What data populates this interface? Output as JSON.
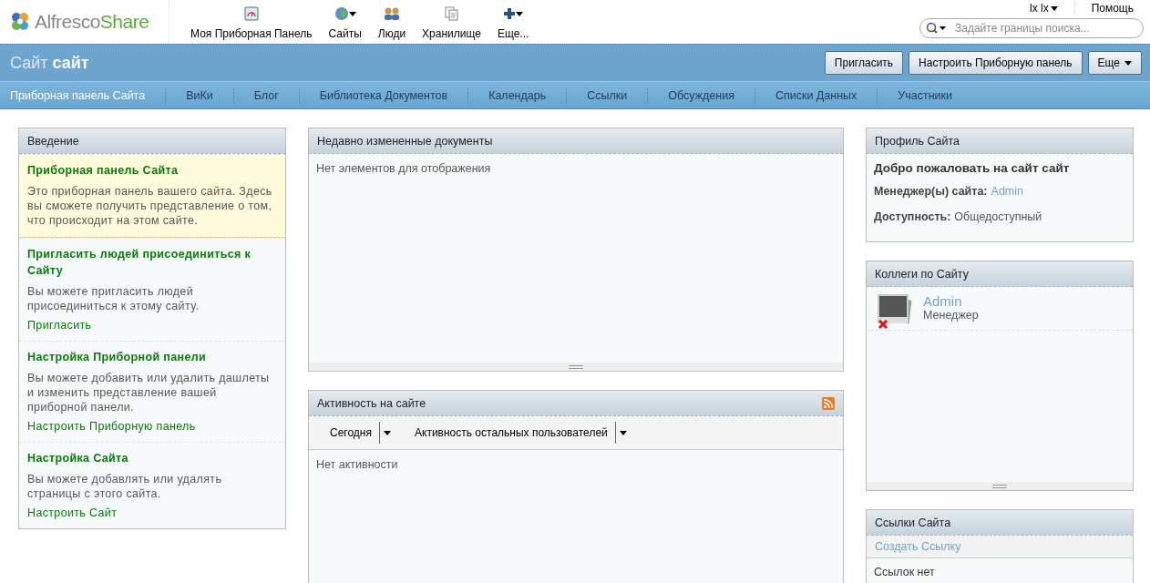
{
  "header": {
    "logo": {
      "brand": "Alfresco",
      "suffix": "Share"
    },
    "apps": [
      {
        "label": "Моя Приборная Панель",
        "kind": "dashboard",
        "dropdown": false
      },
      {
        "label": "Сайты",
        "kind": "globe",
        "dropdown": true
      },
      {
        "label": "Люди",
        "kind": "people",
        "dropdown": false
      },
      {
        "label": "Хранилище",
        "kind": "documents",
        "dropdown": false
      },
      {
        "label": "Еще...",
        "kind": "plus",
        "dropdown": true
      }
    ],
    "user_menu": {
      "label": "lx lx",
      "dropdown": true
    },
    "help": "Помощь",
    "search": {
      "placeholder": "Задайте границы поиска..."
    }
  },
  "site": {
    "prefix": "Сайт",
    "name": "сайт",
    "buttons": [
      {
        "label": "Пригласить",
        "dropdown": false
      },
      {
        "label": "Настроить Приборную панель",
        "dropdown": false
      },
      {
        "label": "Еще",
        "dropdown": true
      }
    ],
    "nav": [
      {
        "label": "Приборная панель Сайта",
        "selected": true
      },
      {
        "label": "ВиКи",
        "selected": false
      },
      {
        "label": "Блог",
        "selected": false
      },
      {
        "label": "Библиотека Документов",
        "selected": false
      },
      {
        "label": "Календарь",
        "selected": false
      },
      {
        "label": "Ссылки",
        "selected": false
      },
      {
        "label": "Обсуждения",
        "selected": false
      },
      {
        "label": "Списки Данных",
        "selected": false
      },
      {
        "label": "Участники",
        "selected": false
      }
    ]
  },
  "intro": {
    "title": "Введение",
    "items": [
      {
        "heading": "Приборная панель Сайта",
        "text": "Это приборная панель вашего сайта. Здесь вы сможете получить представление о том, что происходит на этом сайте.",
        "highlighted": true
      },
      {
        "heading": "Пригласить людей присоединиться к Сайту",
        "text": "Вы можете пригласить людей присоединиться к этому сайту.",
        "link": "Пригласить",
        "highlighted": false
      },
      {
        "heading": "Настройка Приборной панели",
        "text": "Вы можете добавить или удалить дашлеты и изменить представление вашей приборной панели.",
        "link": "Настроить Приборную панель",
        "highlighted": false
      },
      {
        "heading": "Настройка Сайта",
        "text": "Вы можете добавлять или удалять страницы с этого сайта.",
        "link": "Настроить Сайт",
        "highlighted": false
      }
    ]
  },
  "recent_docs": {
    "title": "Недавно измененные документы",
    "empty": "Нет элементов для отображения"
  },
  "activity": {
    "title": "Активность на сайте",
    "filters": [
      {
        "label": "Сегодня"
      },
      {
        "label": "Активность остальных пользователей"
      }
    ],
    "empty": "Нет активности"
  },
  "profile": {
    "title": "Профиль Сайта",
    "welcome": "Добро пожаловать на сайт сайт",
    "managers_label": "Менеджер(ы) сайта:",
    "manager": "Admin",
    "visibility_label": "Доступность:",
    "visibility": "Общедоступный"
  },
  "colleagues": {
    "title": "Коллеги по Сайту",
    "members": [
      {
        "name": "Admin",
        "role": "Менеджер"
      }
    ]
  },
  "links": {
    "title": "Ссылки Сайта",
    "create": "Создать Ссылку",
    "empty": "Ссылок нет"
  }
}
